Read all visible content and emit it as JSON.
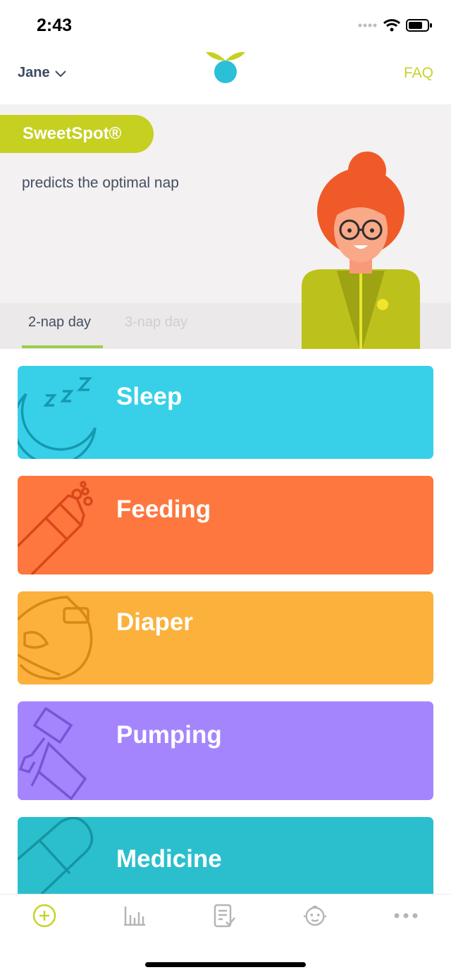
{
  "status_bar": {
    "time": "2:43"
  },
  "header": {
    "profile_name": "Jane",
    "faq_label": "FAQ"
  },
  "promo": {
    "badge": "SweetSpot®",
    "subtitle": "predicts the optimal nap",
    "tabs": [
      {
        "label": "2-nap day",
        "active": true
      },
      {
        "label": "3-nap day",
        "active": false
      }
    ]
  },
  "categories": [
    {
      "label": "Sleep",
      "color": "#37d0e8",
      "icon": "moon-zzz-icon"
    },
    {
      "label": "Feeding",
      "color": "#fd773e",
      "icon": "baby-bottle-icon"
    },
    {
      "label": "Diaper",
      "color": "#fbb13c",
      "icon": "diaper-icon"
    },
    {
      "label": "Pumping",
      "color": "#a585fd",
      "icon": "breast-pump-icon"
    },
    {
      "label": "Medicine",
      "color": "#2bbfcd",
      "icon": "pill-icon"
    }
  ],
  "bottom_nav": [
    {
      "icon": "add-circle-icon",
      "active": true
    },
    {
      "icon": "bar-chart-icon",
      "active": false
    },
    {
      "icon": "checklist-icon",
      "active": false
    },
    {
      "icon": "baby-face-icon",
      "active": false
    },
    {
      "icon": "more-dots-icon",
      "active": false
    }
  ],
  "colors": {
    "accent": "#c7d12d",
    "text_dark": "#3d4a63"
  }
}
